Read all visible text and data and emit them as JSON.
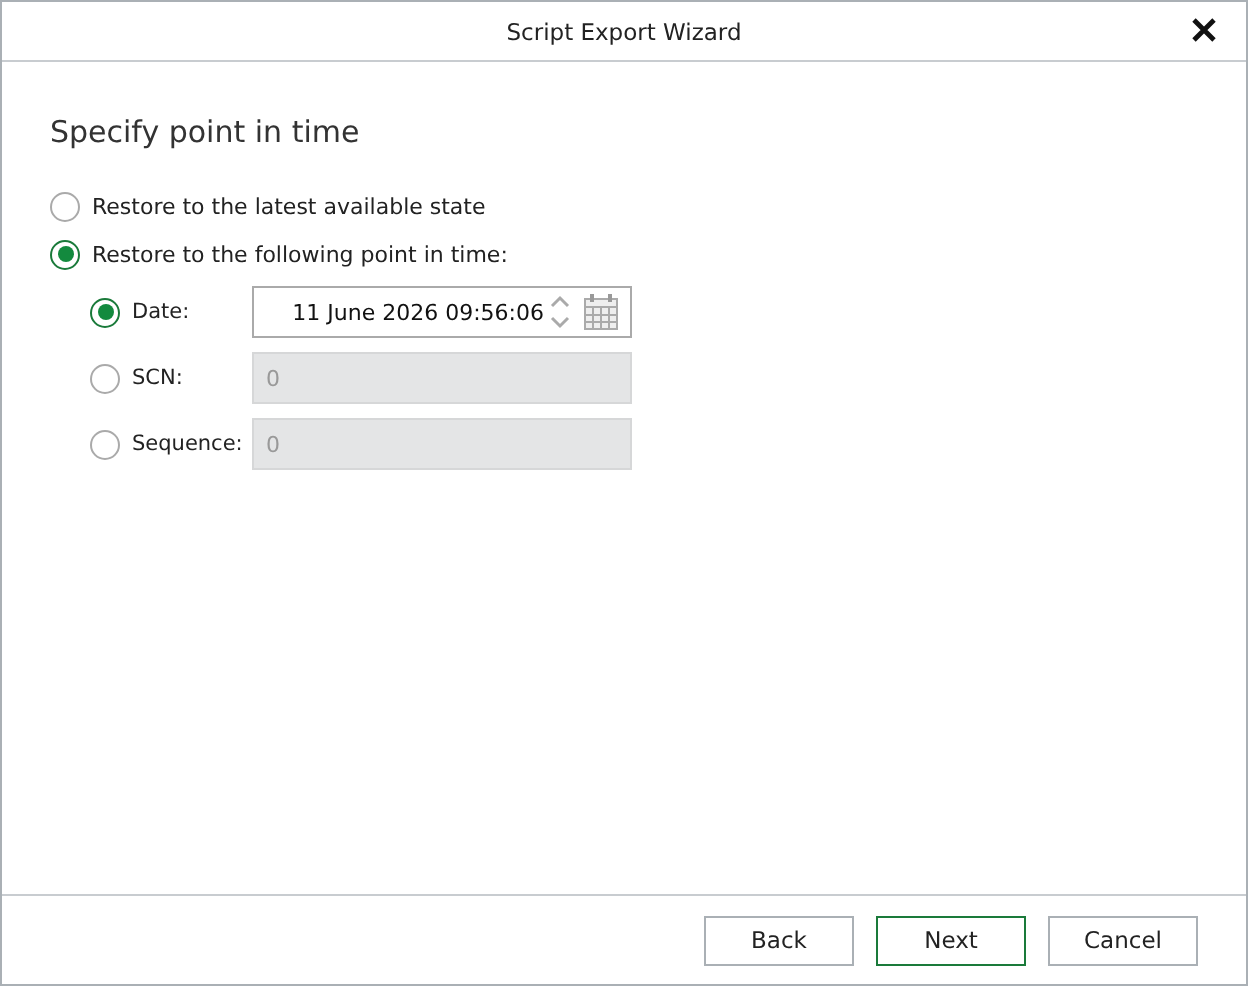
{
  "window": {
    "title": "Script Export Wizard"
  },
  "heading": "Specify point in time",
  "options": [
    {
      "label": "Restore to the latest available state",
      "selected": false
    },
    {
      "label": "Restore to the following point in time:",
      "selected": true
    }
  ],
  "point_options": [
    {
      "label": "Date:",
      "selected": true,
      "kind": "datetime",
      "value": "11 June 2026 09:56:06",
      "disabled": false
    },
    {
      "label": "SCN:",
      "selected": false,
      "kind": "text",
      "value": "0",
      "disabled": true
    },
    {
      "label": "Sequence:",
      "selected": false,
      "kind": "text",
      "value": "0",
      "disabled": true
    }
  ],
  "buttons": [
    {
      "label": "Back",
      "default": false
    },
    {
      "label": "Next",
      "default": true
    },
    {
      "label": "Cancel",
      "default": false
    }
  ]
}
